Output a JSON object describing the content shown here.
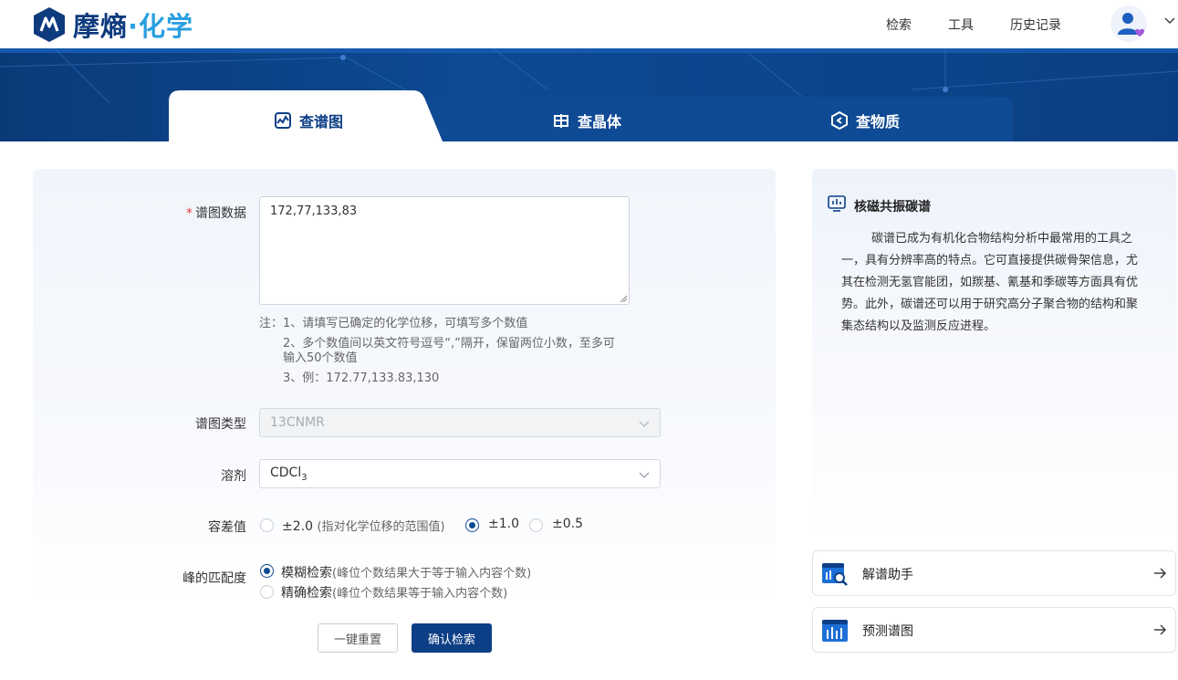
{
  "brand": {
    "name_part1": "摩熵",
    "name_dot": "·",
    "name_part2": "化学"
  },
  "nav": {
    "items": [
      "检索",
      "工具",
      "历史记录"
    ]
  },
  "tabs": [
    {
      "label": "查谱图",
      "icon": "spectrum-icon",
      "active": true
    },
    {
      "label": "查晶体",
      "icon": "crystal-icon",
      "active": false
    },
    {
      "label": "查物质",
      "icon": "substance-icon",
      "active": false
    }
  ],
  "form": {
    "spectrum_data": {
      "label": "谱图数据",
      "required_mark": "*",
      "value": "172,77,133,83"
    },
    "notes": {
      "line1": "注：1、请填写已确定的化学位移，可填写多个数值",
      "line2": "2、多个数值间以英文符号逗号“,”隔开，保留两位小数，至多可",
      "line2b": "输入50个数值",
      "line3": "3、例：172.77,133.83,130"
    },
    "spectrum_type": {
      "label": "谱图类型",
      "value": "13CNMR"
    },
    "solvent": {
      "label": "溶剂",
      "value_main": "CDCl",
      "value_sub": "3"
    },
    "tolerance": {
      "label": "容差值",
      "options": [
        {
          "label": "±2.0",
          "hint": "(指对化学位移的范围值)",
          "selected": false
        },
        {
          "label": "±1.0",
          "hint": "",
          "selected": true
        },
        {
          "label": "±0.5",
          "hint": "",
          "selected": false
        }
      ]
    },
    "peak_match": {
      "label": "峰的匹配度",
      "options": [
        {
          "label": "模糊检索",
          "hint": "(峰位个数结果大于等于输入内容个数)",
          "selected": true
        },
        {
          "label": "精确检索",
          "hint": "(峰位个数结果等于输入内容个数)",
          "selected": false
        }
      ]
    },
    "reset_label": "一键重置",
    "search_label": "确认检索"
  },
  "info": {
    "title": "核磁共振碳谱",
    "text": "碳谱已成为有机化合物结构分析中最常用的工具之一，具有分辨率高的特点。它可直接提供碳骨架信息，尤其在检测无氢官能团，如羰基、氰基和季碳等方面具有优势。此外，碳谱还可以用于研究高分子聚合物的结构和聚集态结构以及监测反应进程。"
  },
  "tools": [
    {
      "label": "解谱助手",
      "icon": "analysis-assistant-icon"
    },
    {
      "label": "预测谱图",
      "icon": "predict-spectrum-icon"
    }
  ],
  "colors": {
    "primary": "#0d3f86",
    "accent": "#2a9fe0",
    "required": "#e23c3c"
  }
}
